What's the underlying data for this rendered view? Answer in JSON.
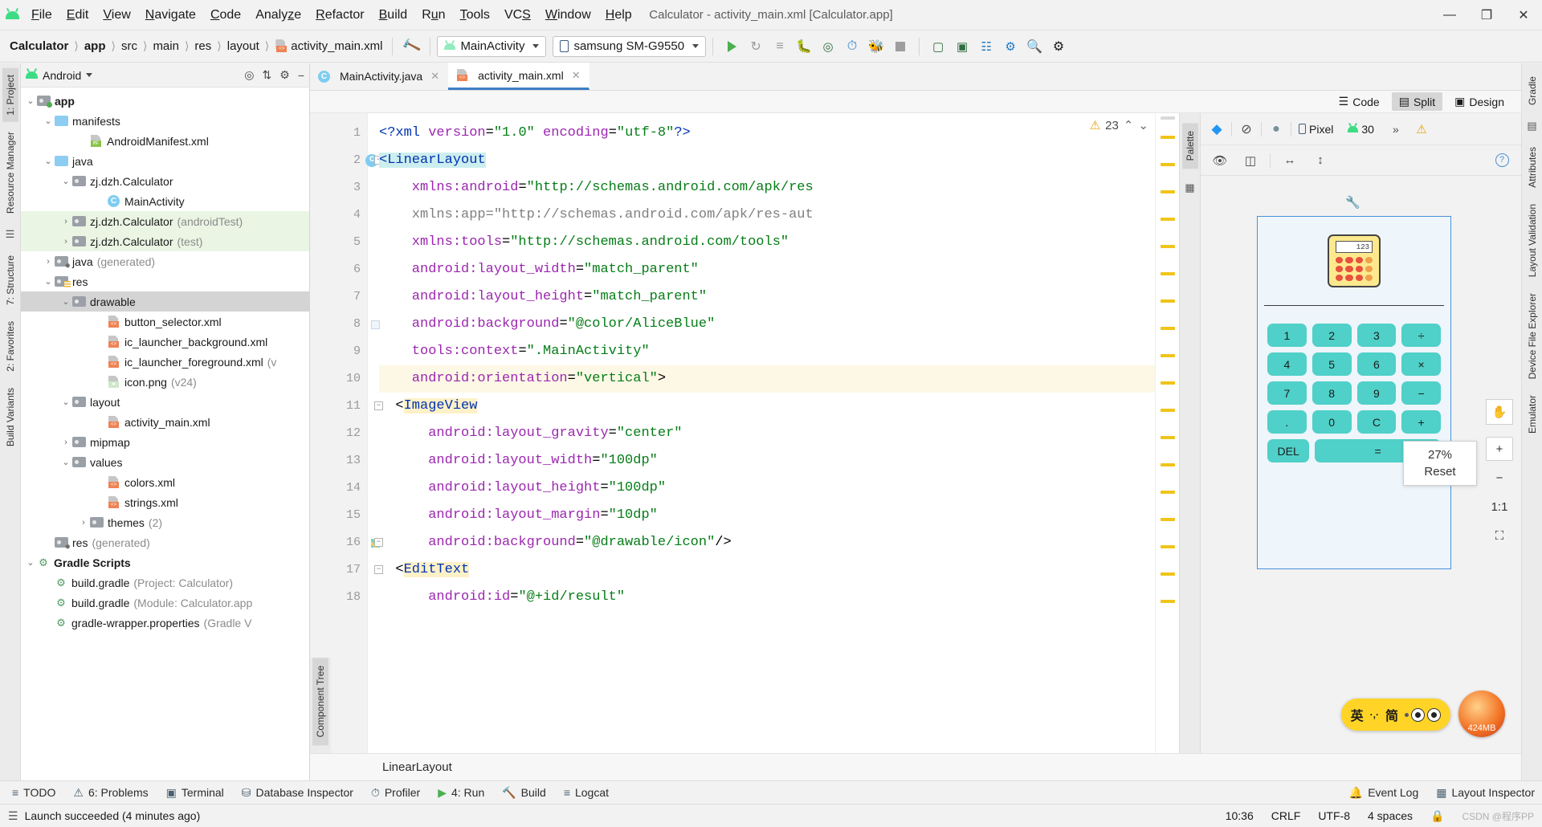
{
  "window": {
    "title": "Calculator - activity_main.xml [Calculator.app]",
    "minimize": "—",
    "maximize": "❐",
    "close": "✕"
  },
  "menubar": [
    {
      "label": "File"
    },
    {
      "label": "Edit"
    },
    {
      "label": "View"
    },
    {
      "label": "Navigate"
    },
    {
      "label": "Code"
    },
    {
      "label": "Analyze"
    },
    {
      "label": "Refactor"
    },
    {
      "label": "Build"
    },
    {
      "label": "Run"
    },
    {
      "label": "Tools"
    },
    {
      "label": "VCS"
    },
    {
      "label": "Window"
    },
    {
      "label": "Help"
    }
  ],
  "navbar": {
    "breadcrumbs": [
      "Calculator",
      "app",
      "src",
      "main",
      "res",
      "layout",
      "activity_main.xml"
    ],
    "run_config": "MainActivity",
    "device": "samsung SM-G9550",
    "icons": [
      "make-project-icon",
      "run-icon",
      "rerun-icon",
      "apply-changes-icon",
      "debug-icon",
      "attach-debugger-icon",
      "profiler-icon",
      "run-with-coverage-icon",
      "stop-icon",
      "avd-manager-icon",
      "sdk-manager-icon",
      "device-manager-icon",
      "layout-inspector-icon",
      "search-icon",
      "notifications-icon"
    ]
  },
  "project_panel": {
    "title": "Android",
    "header_icons": [
      "target-icon",
      "collapse-all-icon",
      "settings-icon",
      "hide-icon"
    ],
    "tree": [
      {
        "label": "app",
        "suffix": "",
        "depth": 0,
        "arrow": "⌄",
        "icon": "folder-module",
        "bold": true
      },
      {
        "label": "manifests",
        "suffix": "",
        "depth": 1,
        "arrow": "⌄",
        "icon": "folder-blue"
      },
      {
        "label": "AndroidManifest.xml",
        "suffix": "",
        "depth": 3,
        "arrow": "",
        "icon": "file-manifest"
      },
      {
        "label": "java",
        "suffix": "",
        "depth": 1,
        "arrow": "⌄",
        "icon": "folder-blue"
      },
      {
        "label": "zj.dzh.Calculator",
        "suffix": "",
        "depth": 2,
        "arrow": "⌄",
        "icon": "folder-pkg"
      },
      {
        "label": "MainActivity",
        "suffix": "",
        "depth": 4,
        "arrow": "",
        "icon": "class"
      },
      {
        "label": "zj.dzh.Calculator",
        "suffix": "(androidTest)",
        "depth": 2,
        "arrow": "›",
        "icon": "folder-pkg",
        "row": "green"
      },
      {
        "label": "zj.dzh.Calculator",
        "suffix": "(test)",
        "depth": 2,
        "arrow": "›",
        "icon": "folder-pkg",
        "row": "green"
      },
      {
        "label": "java",
        "suffix": "(generated)",
        "depth": 1,
        "arrow": "›",
        "icon": "folder-generated"
      },
      {
        "label": "res",
        "suffix": "",
        "depth": 1,
        "arrow": "⌄",
        "icon": "folder-res"
      },
      {
        "label": "drawable",
        "suffix": "",
        "depth": 2,
        "arrow": "⌄",
        "icon": "folder-pkg",
        "row": "sel"
      },
      {
        "label": "button_selector.xml",
        "suffix": "",
        "depth": 4,
        "arrow": "",
        "icon": "file-xml"
      },
      {
        "label": "ic_launcher_background.xml",
        "suffix": "",
        "depth": 4,
        "arrow": "",
        "icon": "file-xml"
      },
      {
        "label": "ic_launcher_foreground.xml",
        "suffix": "(v",
        "depth": 4,
        "arrow": "",
        "icon": "file-xml"
      },
      {
        "label": "icon.png",
        "suffix": "(v24)",
        "depth": 4,
        "arrow": "",
        "icon": "file-png"
      },
      {
        "label": "layout",
        "suffix": "",
        "depth": 2,
        "arrow": "⌄",
        "icon": "folder-pkg"
      },
      {
        "label": "activity_main.xml",
        "suffix": "",
        "depth": 4,
        "arrow": "",
        "icon": "file-xml"
      },
      {
        "label": "mipmap",
        "suffix": "",
        "depth": 2,
        "arrow": "›",
        "icon": "folder-pkg"
      },
      {
        "label": "values",
        "suffix": "",
        "depth": 2,
        "arrow": "⌄",
        "icon": "folder-pkg"
      },
      {
        "label": "colors.xml",
        "suffix": "",
        "depth": 4,
        "arrow": "",
        "icon": "file-xml"
      },
      {
        "label": "strings.xml",
        "suffix": "",
        "depth": 4,
        "arrow": "",
        "icon": "file-xml"
      },
      {
        "label": "themes",
        "suffix": "(2)",
        "depth": 3,
        "arrow": "›",
        "icon": "folder-pkg"
      },
      {
        "label": "res",
        "suffix": "(generated)",
        "depth": 1,
        "arrow": "",
        "icon": "folder-generated"
      },
      {
        "label": "Gradle Scripts",
        "suffix": "",
        "depth": 0,
        "arrow": "⌄",
        "icon": "gradle",
        "bold": true
      },
      {
        "label": "build.gradle",
        "suffix": "(Project: Calculator)",
        "depth": 1,
        "arrow": "",
        "icon": "gradle"
      },
      {
        "label": "build.gradle",
        "suffix": "(Module: Calculator.app",
        "depth": 1,
        "arrow": "",
        "icon": "gradle"
      },
      {
        "label": "gradle-wrapper.properties",
        "suffix": "(Gradle V",
        "depth": 1,
        "arrow": "",
        "icon": "gradle"
      }
    ]
  },
  "left_strip": [
    "1: Project",
    "Resource Manager",
    "7: Structure",
    "2: Favorites",
    "Build Variants"
  ],
  "right_strip": [
    "Gradle",
    "Attributes",
    "Layout Validation",
    "Device File Explorer",
    "Emulator"
  ],
  "editor": {
    "tabs": [
      {
        "label": "MainActivity.java",
        "icon": "java-class-icon",
        "active": false
      },
      {
        "label": "activity_main.xml",
        "icon": "xml-file-icon",
        "active": true
      }
    ],
    "modes": [
      {
        "label": "Code",
        "icon": "code-view-icon",
        "active": false
      },
      {
        "label": "Split",
        "icon": "split-view-icon",
        "active": true
      },
      {
        "label": "Design",
        "icon": "design-view-icon",
        "active": false
      }
    ],
    "warning_count": "23",
    "lines": [
      {
        "n": "1",
        "segments": [
          {
            "t": "<?",
            "c": "tag"
          },
          {
            "t": "xml",
            "c": "tag"
          },
          {
            "t": " version",
            "c": "attr"
          },
          {
            "t": "=",
            "c": "plain"
          },
          {
            "t": "\"1.0\"",
            "c": "str"
          },
          {
            "t": " encoding",
            "c": "attr"
          },
          {
            "t": "=",
            "c": "plain"
          },
          {
            "t": "\"utf-8\"",
            "c": "str"
          },
          {
            "t": "?>",
            "c": "tag"
          }
        ]
      },
      {
        "n": "2",
        "mark": "c",
        "fold": true,
        "segments": [
          {
            "t": "<LinearLayout",
            "c": "elem"
          }
        ]
      },
      {
        "n": "3",
        "segments": [
          {
            "t": "    xmlns:android",
            "c": "attr"
          },
          {
            "t": "=",
            "c": "plain"
          },
          {
            "t": "\"http://schemas.android.com/apk/res",
            "c": "str"
          }
        ]
      },
      {
        "n": "4",
        "segments": [
          {
            "t": "    xmlns:app",
            "c": "gray"
          },
          {
            "t": "=",
            "c": "gray"
          },
          {
            "t": "\"http://schemas.android.com/apk/res-aut",
            "c": "gray"
          }
        ]
      },
      {
        "n": "5",
        "segments": [
          {
            "t": "    xmlns:tools",
            "c": "attr"
          },
          {
            "t": "=",
            "c": "plain"
          },
          {
            "t": "\"http://schemas.android.com/tools\"",
            "c": "str"
          }
        ]
      },
      {
        "n": "6",
        "segments": [
          {
            "t": "    android:layout_width",
            "c": "attr"
          },
          {
            "t": "=",
            "c": "plain"
          },
          {
            "t": "\"match_parent\"",
            "c": "str"
          }
        ]
      },
      {
        "n": "7",
        "segments": [
          {
            "t": "    android:layout_height",
            "c": "attr"
          },
          {
            "t": "=",
            "c": "plain"
          },
          {
            "t": "\"match_parent\"",
            "c": "str"
          }
        ]
      },
      {
        "n": "8",
        "swatch": "#eef5fb",
        "segments": [
          {
            "t": "    android:background",
            "c": "attr"
          },
          {
            "t": "=",
            "c": "plain"
          },
          {
            "t": "\"@color/AliceBlue\"",
            "c": "str"
          }
        ]
      },
      {
        "n": "9",
        "segments": [
          {
            "t": "    tools:context",
            "c": "attr"
          },
          {
            "t": "=",
            "c": "plain"
          },
          {
            "t": "\".MainActivity\"",
            "c": "str"
          }
        ]
      },
      {
        "n": "10",
        "hl": true,
        "segments": [
          {
            "t": "    android:orientation",
            "c": "attr"
          },
          {
            "t": "=",
            "c": "plain"
          },
          {
            "t": "\"vertical\"",
            "c": "str"
          },
          {
            "t": ">",
            "c": "plain"
          }
        ]
      },
      {
        "n": "11",
        "fold": true,
        "segments": [
          {
            "t": "  <",
            "c": "plain"
          },
          {
            "t": "ImageView",
            "c": "elem2"
          }
        ]
      },
      {
        "n": "12",
        "segments": [
          {
            "t": "      android:layout_gravity",
            "c": "attr"
          },
          {
            "t": "=",
            "c": "plain"
          },
          {
            "t": "\"center\"",
            "c": "str"
          }
        ]
      },
      {
        "n": "13",
        "segments": [
          {
            "t": "      android:layout_width",
            "c": "attr"
          },
          {
            "t": "=",
            "c": "plain"
          },
          {
            "t": "\"100dp\"",
            "c": "str"
          }
        ]
      },
      {
        "n": "14",
        "segments": [
          {
            "t": "      android:layout_height",
            "c": "attr"
          },
          {
            "t": "=",
            "c": "plain"
          },
          {
            "t": "\"100dp\"",
            "c": "str"
          }
        ]
      },
      {
        "n": "15",
        "segments": [
          {
            "t": "      android:layout_margin",
            "c": "attr"
          },
          {
            "t": "=",
            "c": "plain"
          },
          {
            "t": "\"10dp\"",
            "c": "str"
          }
        ]
      },
      {
        "n": "16",
        "gimg": true,
        "fold": true,
        "segments": [
          {
            "t": "      android:background",
            "c": "attr"
          },
          {
            "t": "=",
            "c": "plain"
          },
          {
            "t": "\"@drawable/icon\"",
            "c": "str"
          },
          {
            "t": "/>",
            "c": "plain"
          }
        ]
      },
      {
        "n": "17",
        "fold": true,
        "segments": [
          {
            "t": "  <",
            "c": "plain"
          },
          {
            "t": "EditText",
            "c": "elem2"
          }
        ]
      },
      {
        "n": "18",
        "segments": [
          {
            "t": "      android:id",
            "c": "attr"
          },
          {
            "t": "=",
            "c": "plain"
          },
          {
            "t": "\"@+id/result\"",
            "c": "str"
          }
        ]
      }
    ],
    "breadcrumb_status": "LinearLayout"
  },
  "design": {
    "toolbar_icons": [
      "layers-icon",
      "orientation-icon",
      "theme-icon"
    ],
    "device": "Pixel",
    "api_level": "30",
    "more": "»",
    "warning_icon": "warning-icon",
    "toolbar2_icons": [
      "eye-icon",
      "blueprint-icon",
      "horizontal-constraint-icon",
      "vertical-constraint-icon"
    ],
    "help_icon": "help-icon",
    "zoom_percent": "27%",
    "zoom_reset": "Reset",
    "zoom_in": "+",
    "zoom_out": "−",
    "zoom_fit": "1:1",
    "zoom_expand": "⛶",
    "pan_icon": "pan-hand-icon",
    "palette_label": "Palette",
    "component_tree_label": "Component Tree",
    "preview": {
      "icon_display": "123",
      "keys": [
        "1",
        "2",
        "3",
        "÷",
        "4",
        "5",
        "6",
        "×",
        "7",
        "8",
        "9",
        "−",
        ".",
        "0",
        "C",
        "+"
      ],
      "del_key": "DEL",
      "equals_key": "="
    }
  },
  "memory": {
    "label": "424MB"
  },
  "ime": {
    "left": "英",
    "middle": "·,·",
    "right": "简"
  },
  "bottom_tools": [
    {
      "label": "TODO",
      "icon": "todo-icon"
    },
    {
      "label": "6: Problems",
      "icon": "problems-icon"
    },
    {
      "label": "Terminal",
      "icon": "terminal-icon"
    },
    {
      "label": "Database Inspector",
      "icon": "database-icon"
    },
    {
      "label": "Profiler",
      "icon": "profiler-icon"
    },
    {
      "label": "4: Run",
      "icon": "run-icon"
    },
    {
      "label": "Build",
      "icon": "build-icon"
    },
    {
      "label": "Logcat",
      "icon": "logcat-icon"
    },
    {
      "label": "Event Log",
      "icon": "event-log-icon"
    },
    {
      "label": "Layout Inspector",
      "icon": "layout-inspector-icon"
    }
  ],
  "statusbar": {
    "message": "Launch succeeded (4 minutes ago)",
    "time": "10:36",
    "line_sep": "CRLF",
    "encoding": "UTF-8",
    "indent": "4 spaces",
    "watermark": "CSDN @程序PP"
  }
}
